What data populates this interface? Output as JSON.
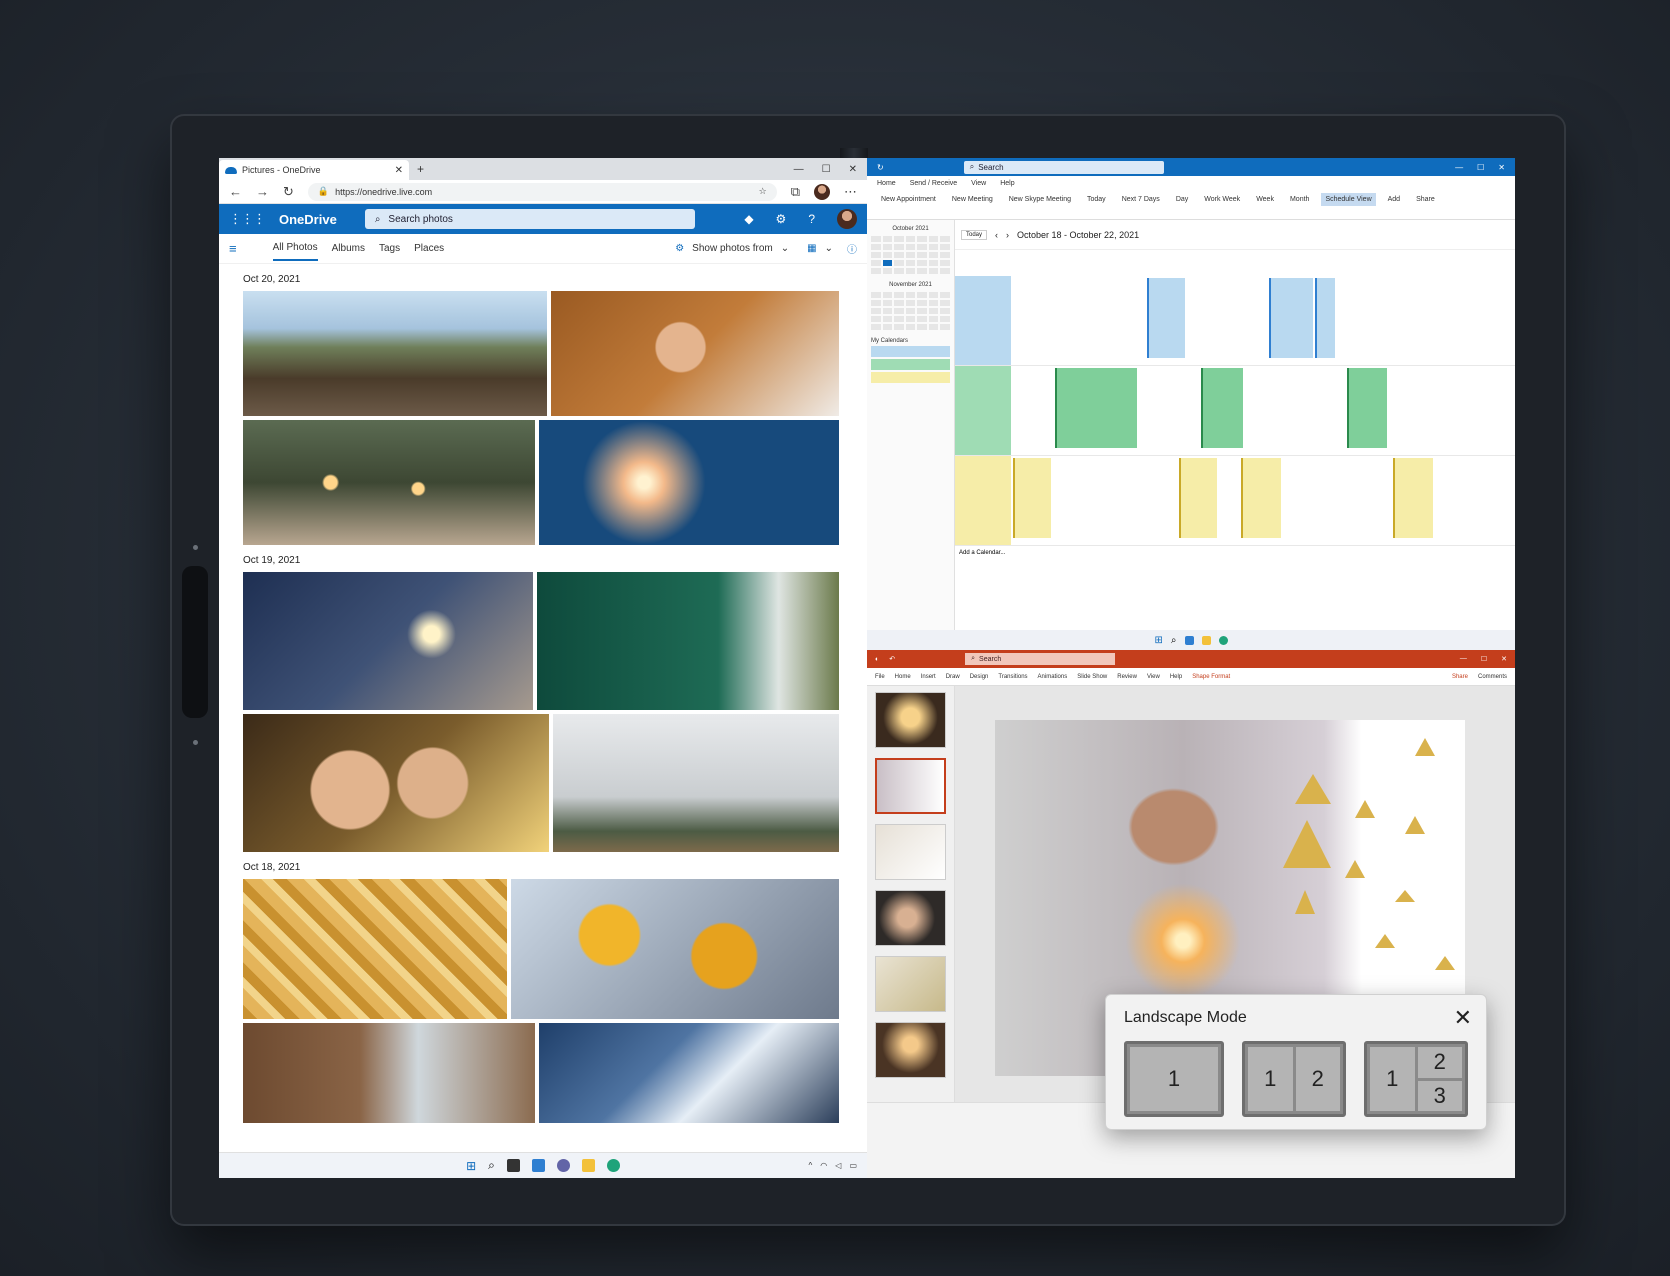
{
  "browser": {
    "tab_title": "Pictures - OneDrive",
    "url": "https://onedrive.live.com"
  },
  "onedrive": {
    "brand": "OneDrive",
    "search_placeholder": "Search photos",
    "nav_tabs": [
      "All Photos",
      "Albums",
      "Tags",
      "Places"
    ],
    "show_photos_label": "Show photos from",
    "groups": [
      {
        "date": "Oct 20, 2021"
      },
      {
        "date": "Oct 19, 2021"
      },
      {
        "date": "Oct 18, 2021"
      }
    ]
  },
  "outlook": {
    "search_text": "Search",
    "ribbon_tabs": [
      "Home",
      "Send / Receive",
      "View",
      "Help"
    ],
    "ribbon_buttons": [
      "New Appointment",
      "New Meeting",
      "New Skype Meeting",
      "Today",
      "Next 7 Days",
      "Day",
      "Work Week",
      "Week",
      "Month",
      "Schedule View",
      "Add",
      "Share"
    ],
    "date_range": "October 18 - October 22, 2021",
    "mini_cal_months": [
      "October 2021",
      "November 2021"
    ],
    "my_calendars": "My Calendars",
    "add_calendar": "Add a Calendar..."
  },
  "powerpoint": {
    "search_text": "Search",
    "ribbon_tabs": [
      "File",
      "Home",
      "Insert",
      "Draw",
      "Design",
      "Transitions",
      "Animations",
      "Slide Show",
      "Review",
      "View",
      "Help",
      "Shape Format"
    ],
    "share_label": "Share",
    "comments_label": "Comments"
  },
  "landscape_mode": {
    "title": "Landscape Mode",
    "option1": {
      "p1": "1"
    },
    "option2": {
      "p1": "1",
      "p2": "2"
    },
    "option3": {
      "p1": "1",
      "p2": "2",
      "p3": "3"
    }
  },
  "colors": {
    "onedrive_blue": "#0f6cbd",
    "powerpoint_red": "#c43e1c"
  }
}
